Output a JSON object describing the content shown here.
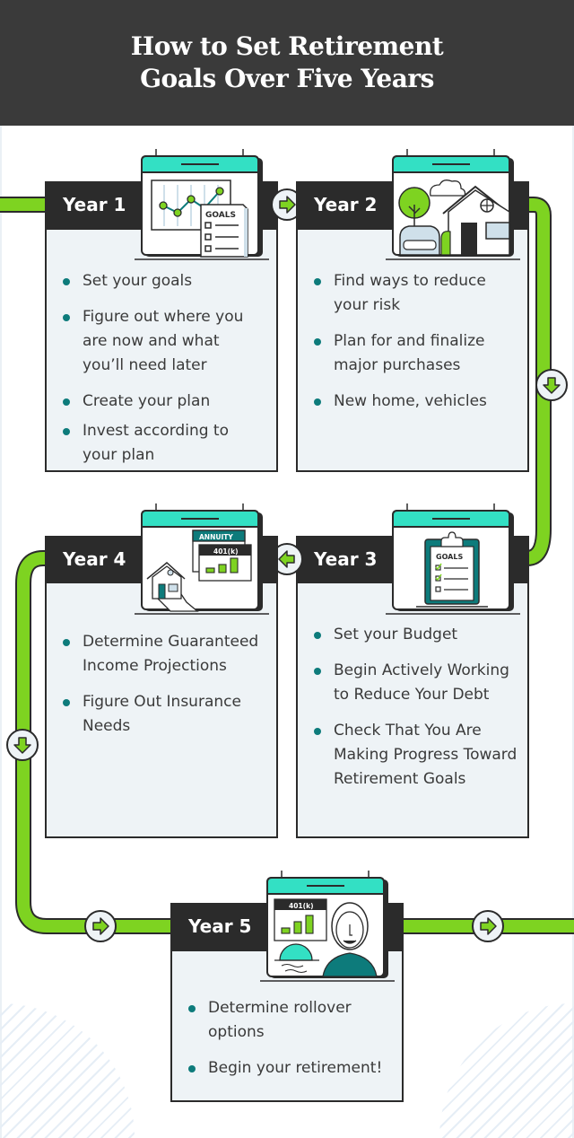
{
  "header": {
    "title_line1": "How to Set Retirement",
    "title_line2": "Goals Over Five Years"
  },
  "colors": {
    "header_bg": "#3a3a3a",
    "card_head_bg": "#2b2b2b",
    "card_body_bg": "#eef3f6",
    "track_green": "#7ed321",
    "bullet_teal": "#0d7b7b",
    "calendar_top": "#33e0c4"
  },
  "steps": [
    {
      "label": "Year 1",
      "icon": "chart-goals-calendar-icon",
      "illustration_text": "GOALS",
      "bullets": [
        "Set your goals",
        "Figure out where you are now and what you’ll need later",
        "Create your plan",
        "Invest according to your plan"
      ]
    },
    {
      "label": "Year 2",
      "icon": "house-car-calendar-icon",
      "bullets": [
        "Find ways to reduce your risk",
        "Plan for and finalize major purchases",
        "New home, vehicles"
      ]
    },
    {
      "label": "Year 3",
      "icon": "goals-clipboard-calendar-icon",
      "illustration_text": "GOALS",
      "bullets": [
        "Set your Budget",
        "Begin Actively Working to Reduce Your Debt",
        "Check That You Are Making Progress Toward Retirement Goals"
      ]
    },
    {
      "label": "Year 4",
      "icon": "annuity-401k-house-calendar-icon",
      "illustration_text_1": "ANNUITY",
      "illustration_text_2": "401(k)",
      "bullets": [
        "Determine Guaranteed Income Projections",
        "Figure Out Insurance Needs"
      ]
    },
    {
      "label": "Year 5",
      "icon": "retiree-401k-sunset-calendar-icon",
      "illustration_text": "401(k)",
      "bullets": [
        "Determine rollover options",
        "Begin your retirement!"
      ]
    }
  ],
  "arrows": {
    "y1_to_y2": "arrow-right-icon",
    "y2_to_y3": "arrow-down-icon",
    "y3_to_y4": "arrow-left-icon",
    "y4_to_y5": "arrow-down-icon",
    "into_y5": "arrow-right-icon",
    "out_y5": "arrow-right-icon"
  }
}
